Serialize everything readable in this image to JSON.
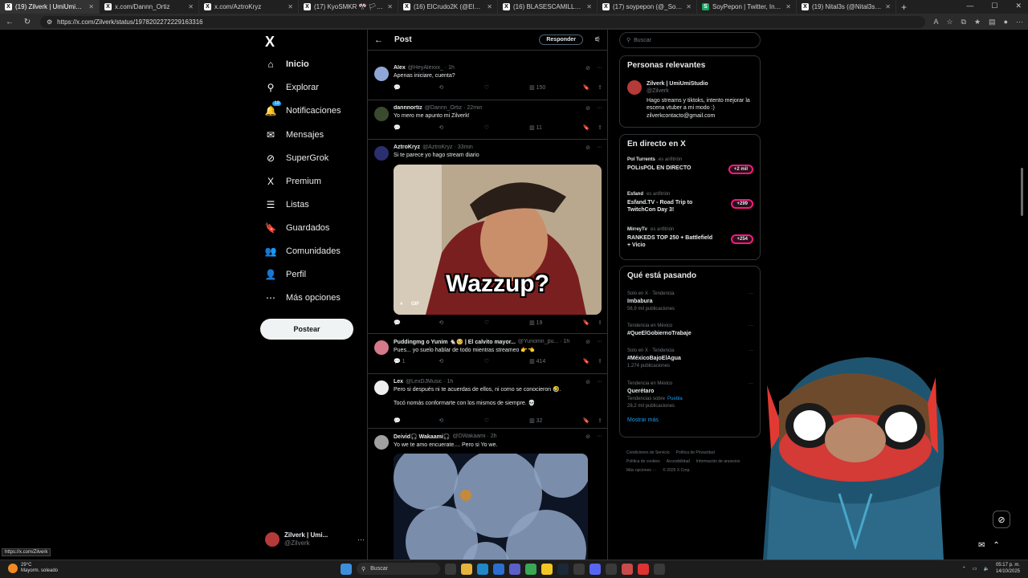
{
  "browser": {
    "tabs": [
      {
        "title": "(19) Zilverk | UmiUmiStudio en X",
        "icon": "X",
        "active": true
      },
      {
        "title": "x.com/Dannn_Ortiz",
        "icon": "X"
      },
      {
        "title": "x.com/AztroKryz",
        "icon": "X"
      },
      {
        "title": "(17) KyoSMKR 🎌 🏳 [SHINKURO]",
        "icon": "X"
      },
      {
        "title": "(16) ElCrudo2K (@ElCrudo2K) / X",
        "icon": "X"
      },
      {
        "title": "(16) BLASESCAMILLA (@blasesca",
        "icon": "X"
      },
      {
        "title": "(17) soypepon (@_SoyPepon) / X",
        "icon": "X"
      },
      {
        "title": "SoyPepon | Twitter, Instagram, Tik",
        "icon": "S"
      },
      {
        "title": "(19) Nital3s (@Nital3sYT) / X",
        "icon": "X"
      }
    ],
    "new_tab": "+",
    "url": "https://x.com/Zilverk/status/1978202272229163316",
    "status_url": "https://x.com/Zilverk"
  },
  "sidebar": {
    "logo": "X",
    "items": [
      {
        "label": "Inicio",
        "icon": "home-icon",
        "glyph": "⌂"
      },
      {
        "label": "Explorar",
        "icon": "search-icon",
        "glyph": "⚲"
      },
      {
        "label": "Notificaciones",
        "icon": "bell-icon",
        "glyph": "🔔",
        "badge": "19"
      },
      {
        "label": "Mensajes",
        "icon": "mail-icon",
        "glyph": "✉"
      },
      {
        "label": "SuperGrok",
        "icon": "grok-icon",
        "glyph": "⊘"
      },
      {
        "label": "Premium",
        "icon": "x-premium-icon",
        "glyph": "X"
      },
      {
        "label": "Listas",
        "icon": "list-icon",
        "glyph": "☰"
      },
      {
        "label": "Guardados",
        "icon": "bookmark-icon",
        "glyph": "🔖"
      },
      {
        "label": "Comunidades",
        "icon": "community-icon",
        "glyph": "👥"
      },
      {
        "label": "Perfil",
        "icon": "person-icon",
        "glyph": "👤"
      },
      {
        "label": "Más opciones",
        "icon": "more-circle-icon",
        "glyph": "⋯"
      }
    ],
    "post_button": "Postear",
    "account": {
      "name": "Zilverk | Umi...",
      "handle": "@Zilverk",
      "more": "···"
    }
  },
  "center": {
    "back": "←",
    "title": "Post",
    "reply_button": "Responder",
    "tweets": [
      {
        "name": "Alex",
        "handle": "@HeyAlexxx_ · 1h",
        "text": "Apenas iniciare, cuenta?",
        "views": "150",
        "avatar_color": "#8ea7d6"
      },
      {
        "name": "dannnortiz",
        "handle": "@Dannn_Ortiz · 22min",
        "text": "Yo mero me apunto mi Zilverk!",
        "views": "11",
        "avatar_color": "#3a4a2e"
      },
      {
        "name": "AztroKryz",
        "handle": "@AztroKryz · 33min",
        "text": "Si te parece yo hago stream diario",
        "views": "19",
        "avatar_color": "#2a2f6e",
        "gif_label": "GIF",
        "gif_caption": "Wazzup?"
      },
      {
        "name": "Puddingmg o Yunim 🐁🥺 | El calvito mayor...",
        "handle": "@Yunomn_pu... · 1h",
        "text": "Pues... yo suelo hablar de todo mientras streameo 👉👈",
        "replies": "1",
        "views": "414",
        "avatar_color": "#d47a8a"
      },
      {
        "name": "Lex",
        "handle": "@LexDJMusic · 1h",
        "text": "Pero si después ni te acuerdas de ellos, ni como se conocieron 🤣.",
        "text2": "Tocó nomás conformarte con los mismos de siempre. 💀",
        "views": "32",
        "avatar_color": "#eeeeee"
      },
      {
        "name": "Deivid🎧 Wakaami🎧",
        "handle": "@DWakaami · 2h",
        "text": "Yo we te amo encuerate.... Pero si Yo we.",
        "avatar_color": "#a0a0a0"
      }
    ]
  },
  "right": {
    "search_placeholder": "Buscar",
    "relevant": {
      "title": "Personas relevantes",
      "name": "Zilverk | UmiUmiStudio",
      "handle": "@Zilverk",
      "bio": "Hago streams y tiktoks, intento mejorar la escena vtuber a mi modo :) zilverkcontacto@gmail.com"
    },
    "live": {
      "title": "En directo en X",
      "items": [
        {
          "host": "Pol Turrents",
          "host_suffix": "es anfitrión",
          "title": "POLisPOL EN DIRECTO",
          "count": "+2 mil"
        },
        {
          "host": "Esfand",
          "host_suffix": "es anfitrión",
          "title": "Esfand.TV - Road Trip to TwitchCon Day 3!",
          "count": "+299"
        },
        {
          "host": "MirreyTv",
          "host_suffix": "es anfitrión",
          "title": "RANKEDS TOP 250 + Battlefield + Vicio",
          "count": "+254"
        }
      ]
    },
    "trends": {
      "title": "Qué está pasando",
      "items": [
        {
          "context": "Solo en X · Tendencia",
          "name": "Imbabura",
          "posts": "56,9 mil publicaciones"
        },
        {
          "context": "Tendencia en México",
          "name": "#QueElGobiernoTrabaje",
          "posts": ""
        },
        {
          "context": "Solo en X · Tendencia",
          "name": "#MéxicoBajoElAgua",
          "posts": "1.274 publicaciones"
        },
        {
          "context": "Tendencia en México",
          "name": "Querétaro",
          "sub": "Tendencias sobre",
          "sub_link": "Puebla",
          "posts": "28,2 mil publicaciones"
        }
      ],
      "show_more": "Mostrar más"
    },
    "footer": [
      "Condiciones de Servicio",
      "Política de Privacidad",
      "Política de cookies",
      "Accesibilidad",
      "Información de anuncios",
      "Más opciones ···",
      "© 2025 X Corp."
    ]
  },
  "taskbar": {
    "weather_temp": "29°C",
    "weather_desc": "Mayorm. soleado",
    "search": "Buscar",
    "time": "05:17 p. m.",
    "date": "14/10/2025"
  }
}
